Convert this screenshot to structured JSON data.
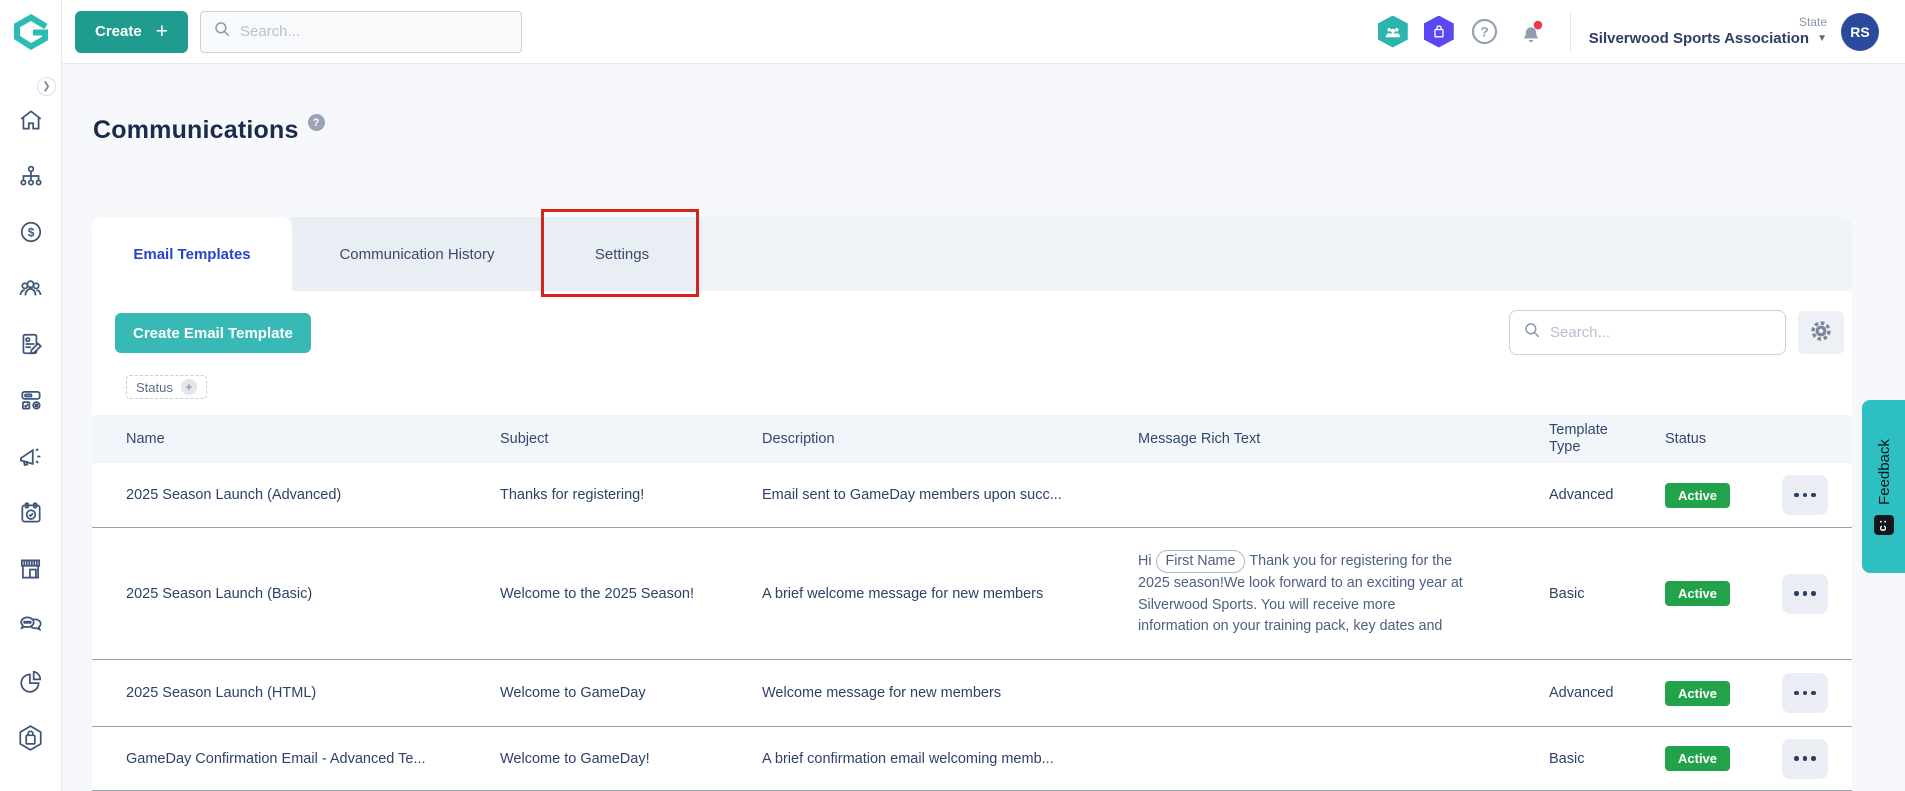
{
  "topbar": {
    "create_label": "Create",
    "search_placeholder": "Search...",
    "icons": [
      "community-icon",
      "marketplace-icon",
      "help-icon",
      "notifications-bell-icon"
    ],
    "org_type": "State",
    "org_name": "Silverwood Sports Association",
    "avatar_initials": "RS"
  },
  "sidebar": {
    "icons": [
      "home-icon",
      "organisation-icon",
      "finance-icon",
      "members-icon",
      "registrations-icon",
      "products-icon",
      "communications-icon",
      "events-icon",
      "shop-icon",
      "messages-icon",
      "reports-icon",
      "marketplace-icon"
    ]
  },
  "page": {
    "title": "Communications"
  },
  "tabs": [
    {
      "label": "Email Templates",
      "active": true
    },
    {
      "label": "Communication History",
      "active": false
    },
    {
      "label": "Settings",
      "active": false,
      "annotated": true
    }
  ],
  "toolbar": {
    "create_template_label": "Create Email Template",
    "search_placeholder": "Search...",
    "filter_chip_label": "Status"
  },
  "table": {
    "columns": [
      "Name",
      "Subject",
      "Description",
      "Message Rich Text",
      "Template Type",
      "Status"
    ],
    "rows": [
      {
        "name": "2025 Season Launch (Advanced)",
        "subject": "Thanks for registering!",
        "description": "Email sent to GameDay members upon succ...",
        "message": {
          "prefix": "",
          "chip": "",
          "suffix": ""
        },
        "template_type": "Advanced",
        "status": "Active"
      },
      {
        "name": "2025 Season Launch (Basic)",
        "subject": "Welcome to the 2025 Season!",
        "description": "A brief welcome message for new members",
        "message": {
          "prefix": "Hi",
          "chip": "First Name",
          "suffix": "Thank you for registering for the 2025 season!We look forward to an exciting year at Silverwood Sports. You will receive more information on your training pack, key dates and"
        },
        "template_type": "Basic",
        "status": "Active"
      },
      {
        "name": "2025 Season Launch (HTML)",
        "subject": "Welcome to GameDay",
        "description": "Welcome message for new members",
        "message": {
          "prefix": "",
          "chip": "",
          "suffix": ""
        },
        "template_type": "Advanced",
        "status": "Active"
      },
      {
        "name": "GameDay Confirmation Email - Advanced Te...",
        "subject": "Welcome to GameDay!",
        "description": "A brief confirmation email welcoming memb...",
        "message": {
          "prefix": "",
          "chip": "",
          "suffix": ""
        },
        "template_type": "Basic",
        "status": "Active"
      }
    ]
  },
  "feedback": {
    "label": "Feedback",
    "icon_glyph": "c:"
  },
  "colors": {
    "brand_teal": "#2cbcb4",
    "create_button": "#1f9c8f",
    "create_template_button": "#38b9b5",
    "active_badge": "#23a24c",
    "community_hex": "#2cb5ae",
    "marketplace_hex": "#5a49f0",
    "notification_dot": "#e93a4f",
    "avatar_blue": "#2b4a9e",
    "active_tab_text": "#2746c8",
    "annotation_red": "#d2251c",
    "feedback_tab": "#2ebfc2"
  }
}
